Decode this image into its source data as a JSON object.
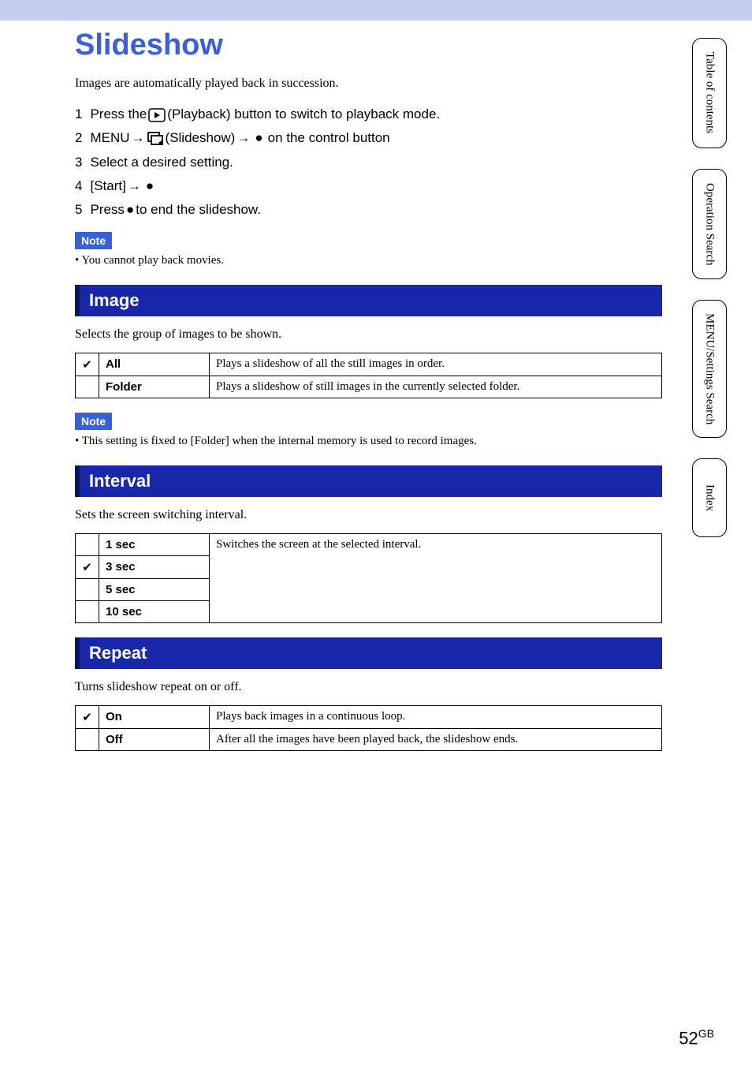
{
  "title": "Slideshow",
  "intro": "Images are automatically played back in succession.",
  "steps": {
    "s1_prefix": "Press the ",
    "s1_suffix": " (Playback) button to switch to playback mode.",
    "s2_prefix": "MENU ",
    "s2_mid": " (Slideshow) ",
    "s2_suffix": " on the control button",
    "s3": "Select a desired setting.",
    "s4_prefix": "[Start] ",
    "s5_prefix": "Press ",
    "s5_suffix": " to end the slideshow."
  },
  "note_label": "Note",
  "note1": "•  You cannot play back movies.",
  "section_image": {
    "title": "Image",
    "desc": "Selects the group of images to be shown.",
    "rows": [
      {
        "check": "✔",
        "name": "All",
        "desc": "Plays a slideshow of all the still images in order."
      },
      {
        "check": "",
        "name": "Folder",
        "desc": "Plays a slideshow of still images in the currently selected folder."
      }
    ]
  },
  "note2": "•  This setting is fixed to [Folder] when the internal memory is used to record images.",
  "section_interval": {
    "title": "Interval",
    "desc": "Sets the screen switching interval.",
    "shared_desc": "Switches the screen at the selected interval.",
    "rows": [
      {
        "check": "",
        "name": "1 sec"
      },
      {
        "check": "✔",
        "name": "3 sec"
      },
      {
        "check": "",
        "name": "5 sec"
      },
      {
        "check": "",
        "name": "10 sec"
      }
    ]
  },
  "section_repeat": {
    "title": "Repeat",
    "desc": "Turns slideshow repeat on or off.",
    "rows": [
      {
        "check": "✔",
        "name": "On",
        "desc": "Plays back images in a continuous loop."
      },
      {
        "check": "",
        "name": "Off",
        "desc": "After all the images have been played back, the slideshow ends."
      }
    ]
  },
  "tabs": {
    "toc": "Table of contents",
    "op": "Operation Search",
    "menu": "MENU/Settings Search",
    "index": "Index"
  },
  "page_num": "52",
  "page_suffix": "GB",
  "arrow": "→",
  "dot": "●"
}
